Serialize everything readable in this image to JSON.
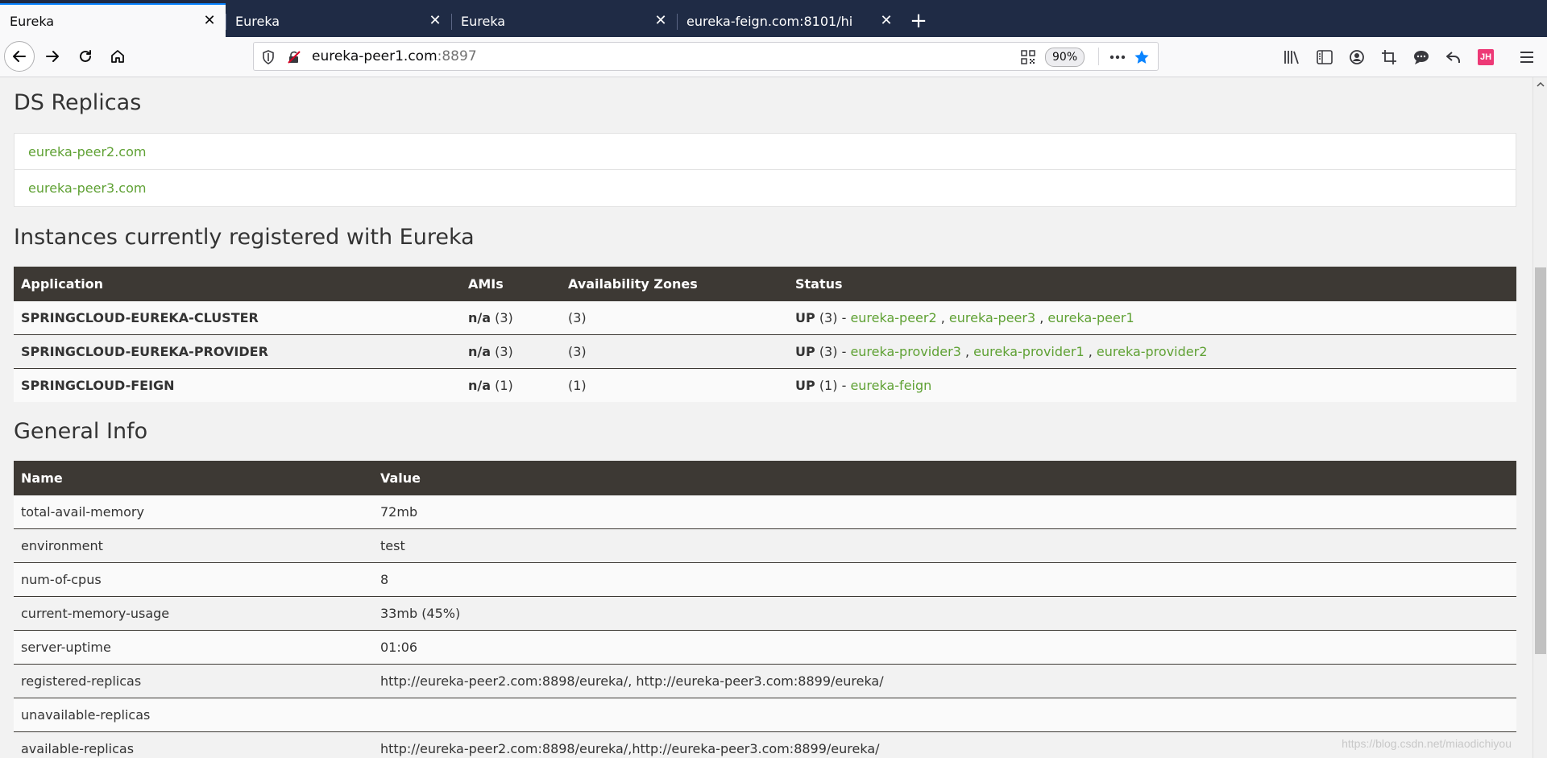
{
  "tabs": [
    {
      "title": "Eureka",
      "active": true
    },
    {
      "title": "Eureka",
      "active": false
    },
    {
      "title": "Eureka",
      "active": false
    },
    {
      "title": "eureka-feign.com:8101/hi",
      "active": false
    }
  ],
  "tab_close_glyph": "✕",
  "new_tab_glyph": "+",
  "urlbar": {
    "host": "eureka-peer1.com",
    "port": ":8897",
    "zoom": "90%"
  },
  "profile_initials": "JH",
  "page": {
    "ds_replicas_title": "DS Replicas",
    "ds_replicas": [
      "eureka-peer2.com",
      "eureka-peer3.com"
    ],
    "instances_title": "Instances currently registered with Eureka",
    "instances_headers": [
      "Application",
      "AMIs",
      "Availability Zones",
      "Status"
    ],
    "instances": [
      {
        "application": "SPRINGCLOUD-EUREKA-CLUSTER",
        "amis_label": "n/a",
        "amis_count": "(3)",
        "zones": "(3)",
        "status": "UP",
        "status_count": "(3) -",
        "links": [
          "eureka-peer2",
          "eureka-peer3",
          "eureka-peer1"
        ]
      },
      {
        "application": "SPRINGCLOUD-EUREKA-PROVIDER",
        "amis_label": "n/a",
        "amis_count": "(3)",
        "zones": "(3)",
        "status": "UP",
        "status_count": "(3) -",
        "links": [
          "eureka-provider3",
          "eureka-provider1",
          "eureka-provider2"
        ]
      },
      {
        "application": "SPRINGCLOUD-FEIGN",
        "amis_label": "n/a",
        "amis_count": "(1)",
        "zones": "(1)",
        "status": "UP",
        "status_count": "(1) -",
        "links": [
          "eureka-feign"
        ]
      }
    ],
    "general_title": "General Info",
    "general_headers": [
      "Name",
      "Value"
    ],
    "general": [
      {
        "name": "total-avail-memory",
        "value": "72mb"
      },
      {
        "name": "environment",
        "value": "test"
      },
      {
        "name": "num-of-cpus",
        "value": "8"
      },
      {
        "name": "current-memory-usage",
        "value": "33mb (45%)"
      },
      {
        "name": "server-uptime",
        "value": "01:06"
      },
      {
        "name": "registered-replicas",
        "value": "http://eureka-peer2.com:8898/eureka/, http://eureka-peer3.com:8899/eureka/"
      },
      {
        "name": "unavailable-replicas",
        "value": ""
      },
      {
        "name": "available-replicas",
        "value": "http://eureka-peer2.com:8898/eureka/,http://eureka-peer3.com:8899/eureka/"
      }
    ]
  },
  "watermark": "https://blog.csdn.net/miaodichiyou",
  "colors": {
    "link": "#5fa134",
    "table_header": "#3d3934",
    "tabbar": "#1f2b45",
    "accent": "#0a84ff"
  }
}
